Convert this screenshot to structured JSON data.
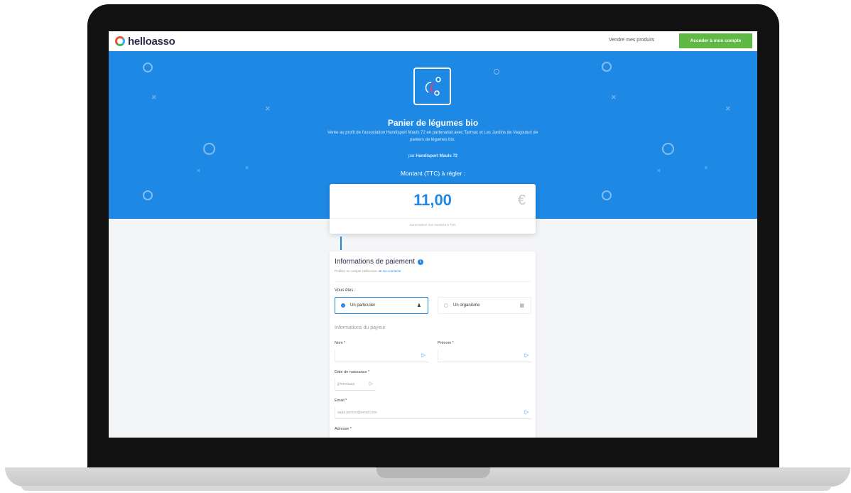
{
  "header": {
    "logo_text": "helloasso",
    "sell_link": "Vendre mes produits",
    "account_button": "Accéder à mon compte"
  },
  "hero": {
    "title": "Panier de légumes bio",
    "description": "Vente au profit de l'association Handisport Mauls 72 en partenariat avec Tarmac et Les Jardins de Vaujouturi de paniers de légumes bio.",
    "by_prefix": "par",
    "organization": "Handisport Mauls 72",
    "amount_label": "Montant (TTC) à régler :"
  },
  "amount": {
    "value": "11,00",
    "currency": "€",
    "note": "Commission non soumise à TVA"
  },
  "payment": {
    "title": "Informations de paiement",
    "subtitle": "Profitez en compte HelloAsso.",
    "subtitle_link": "Je me connecte",
    "you_are_label": "Vous êtes :",
    "option_particulier": "Un particulier",
    "option_organisme": "Un organisme",
    "payer_section": "Informations du payeur",
    "nom_label": "Nom *",
    "prenom_label": "Prénom *",
    "dob_label": "Date de naissance *",
    "dob_placeholder": "jj/mm/aaaa",
    "email_label": "Email *",
    "email_placeholder": "aaaa.person@email.com",
    "address_label": "Adresse *"
  },
  "colors": {
    "primary_blue": "#1e88e5",
    "accent_green": "#5fb944",
    "brand_dark": "#2d2d4a"
  }
}
